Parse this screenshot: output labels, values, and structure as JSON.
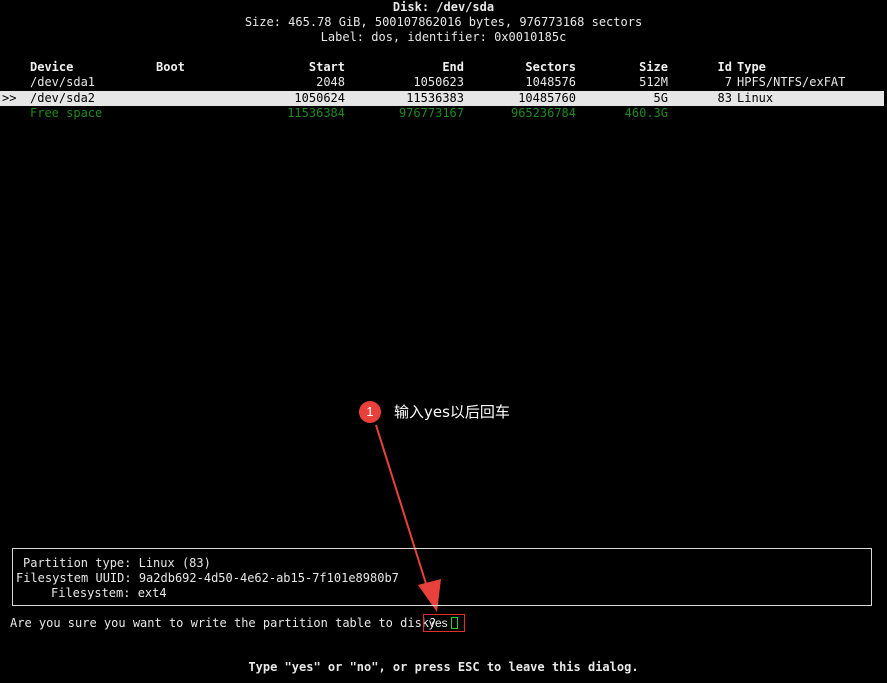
{
  "disk": {
    "title": "Disk: /dev/sda",
    "size_line": "Size: 465.78 GiB, 500107862016 bytes, 976773168 sectors",
    "label_line": "Label: dos, identifier: 0x0010185c"
  },
  "table": {
    "headers": {
      "device": "Device",
      "boot": "Boot",
      "start": "Start",
      "end": "End",
      "sectors": "Sectors",
      "size": "Size",
      "id": "Id",
      "type": "Type"
    },
    "rows": [
      {
        "marker": "",
        "device": "/dev/sda1",
        "boot": "",
        "start": "2048",
        "end": "1050623",
        "sectors": "1048576",
        "size": "512M",
        "id": "7",
        "type": "HPFS/NTFS/exFAT"
      },
      {
        "marker": ">>",
        "device": "/dev/sda2",
        "boot": "",
        "start": "1050624",
        "end": "11536383",
        "sectors": "10485760",
        "size": "5G",
        "id": "83",
        "type": "Linux"
      },
      {
        "marker": "",
        "device": "Free space",
        "boot": "",
        "start": "11536384",
        "end": "976773167",
        "sectors": "965236784",
        "size": "460.3G",
        "id": "",
        "type": ""
      }
    ]
  },
  "info": {
    "partition_type": "Partition type: Linux (83)",
    "filesystem_uuid": "Filesystem UUID: 9a2db692-4d50-4e62-ab15-7f101e8980b7",
    "filesystem": "Filesystem: ext4"
  },
  "prompt": {
    "question": "Are you sure you want to write the partition table to disk?",
    "answer_value": "yes"
  },
  "hint": "Type \"yes\" or \"no\", or press ESC to leave this dialog.",
  "annotation": {
    "number": "1",
    "text": "输入yes以后回车"
  },
  "colors": {
    "background": "#000000",
    "text": "#e8e8e8",
    "selected_row_bg": "#e6e6e6",
    "free_space": "#1d8a1d",
    "annotation_red": "#e8413b",
    "cursor_green": "#2ad32a"
  }
}
